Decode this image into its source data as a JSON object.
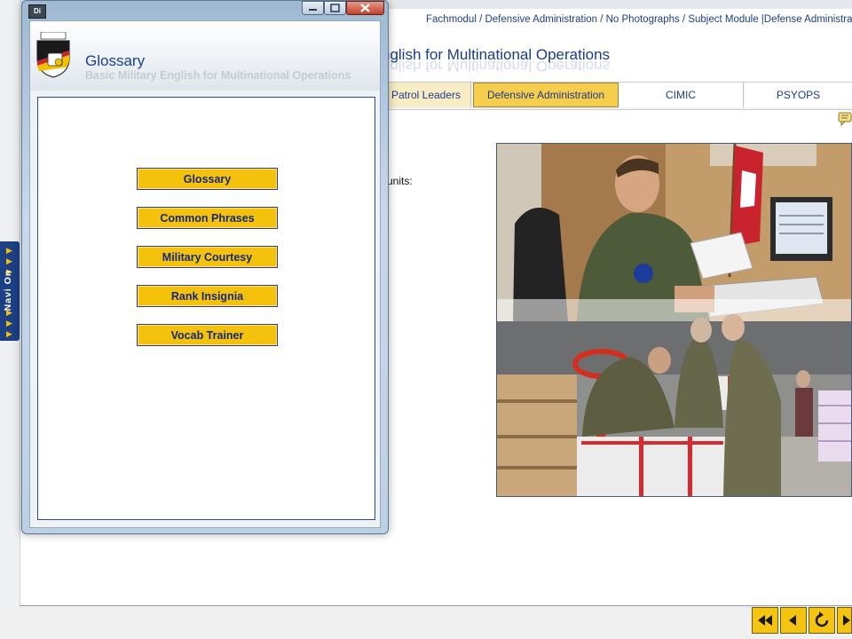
{
  "app": {
    "breadcrumb": "Fachmodul / Defensive Administration / No Photographs / Subject Module |Defense Administration| |",
    "title_fragment": "nglish for Multinational Operations",
    "tabs": [
      {
        "label": "Patrol Leaders",
        "state": "light"
      },
      {
        "label": "Defensive Administration",
        "state": "active"
      },
      {
        "label": "CIMIC",
        "state": "normal"
      },
      {
        "label": "PSYOPS",
        "state": "normal"
      }
    ],
    "content_text_fragment": "units:",
    "navi_label": "Navi On",
    "nav_buttons": [
      {
        "icon": "rewind-icon"
      },
      {
        "icon": "back-icon"
      },
      {
        "icon": "reload-icon"
      },
      {
        "icon": "forward-icon"
      }
    ],
    "info_icon": "comment-icon"
  },
  "window": {
    "app_icon_label": "Di",
    "title": "Glossary",
    "subtitle": "Basic Military English for Multinational Operations",
    "logo_icon": "bundeswehr-logo-icon",
    "menu": [
      {
        "label": "Glossary"
      },
      {
        "label": "Common Phrases"
      },
      {
        "label": "Military Courtesy"
      },
      {
        "label": "Rank Insignia"
      },
      {
        "label": "Vocab Trainer"
      }
    ]
  },
  "colors": {
    "accent_yellow": "#f4c20d",
    "brand_blue": "#173f8c",
    "navi_blue": "#1c3f86"
  }
}
